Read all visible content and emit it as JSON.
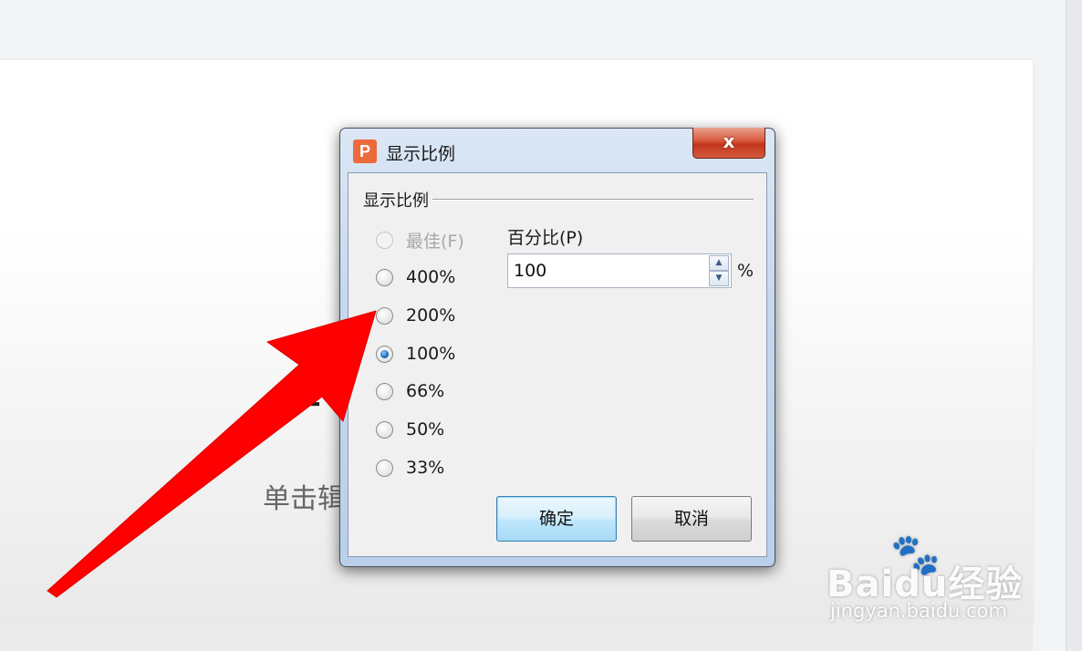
{
  "slide": {
    "title_fragment": "宝",
    "subtitle_fragment": "单击辑"
  },
  "dialog": {
    "app_icon": "P",
    "title": "显示比例",
    "close_glyph": "x",
    "group_label": "显示比例",
    "options": [
      {
        "label": "最佳(F)",
        "checked": false,
        "disabled": true
      },
      {
        "label": "400%",
        "checked": false,
        "disabled": false
      },
      {
        "label": "200%",
        "checked": false,
        "disabled": false
      },
      {
        "label": "100%",
        "checked": true,
        "disabled": false
      },
      {
        "label": "66%",
        "checked": false,
        "disabled": false
      },
      {
        "label": "50%",
        "checked": false,
        "disabled": false
      },
      {
        "label": "33%",
        "checked": false,
        "disabled": false
      }
    ],
    "percent_label": "百分比(P)",
    "percent_value": "100",
    "percent_unit": "%",
    "ok_label": "确定",
    "cancel_label": "取消"
  },
  "annotation": {
    "arrow_color": "#ff0000"
  },
  "watermark": {
    "brand": "Baidu经验",
    "url": "jingyan.baidu.com"
  }
}
